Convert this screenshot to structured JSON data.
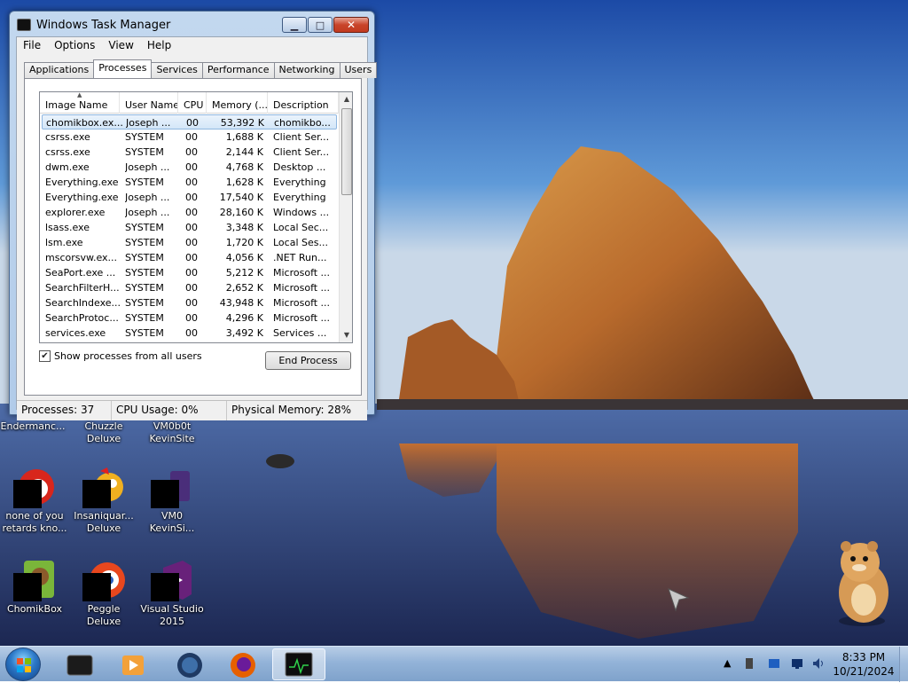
{
  "window": {
    "title": "Windows Task Manager",
    "minimize_glyph": "▁",
    "maximize_glyph": "□",
    "close_glyph": "✕"
  },
  "menu": [
    "File",
    "Options",
    "View",
    "Help"
  ],
  "tabs": [
    "Applications",
    "Processes",
    "Services",
    "Performance",
    "Networking",
    "Users"
  ],
  "active_tab": "Processes",
  "columns": [
    "Image Name",
    "User Name",
    "CPU",
    "Memory (...",
    "Description"
  ],
  "processes": [
    {
      "name": "chomikbox.ex...",
      "user": "Joseph ...",
      "cpu": "00",
      "mem": "53,392 K",
      "desc": "chomikbo..."
    },
    {
      "name": "csrss.exe",
      "user": "SYSTEM",
      "cpu": "00",
      "mem": "1,688 K",
      "desc": "Client Ser..."
    },
    {
      "name": "csrss.exe",
      "user": "SYSTEM",
      "cpu": "00",
      "mem": "2,144 K",
      "desc": "Client Ser..."
    },
    {
      "name": "dwm.exe",
      "user": "Joseph ...",
      "cpu": "00",
      "mem": "4,768 K",
      "desc": "Desktop ..."
    },
    {
      "name": "Everything.exe",
      "user": "SYSTEM",
      "cpu": "00",
      "mem": "1,628 K",
      "desc": "Everything"
    },
    {
      "name": "Everything.exe",
      "user": "Joseph ...",
      "cpu": "00",
      "mem": "17,540 K",
      "desc": "Everything"
    },
    {
      "name": "explorer.exe",
      "user": "Joseph ...",
      "cpu": "00",
      "mem": "28,160 K",
      "desc": "Windows ..."
    },
    {
      "name": "lsass.exe",
      "user": "SYSTEM",
      "cpu": "00",
      "mem": "3,348 K",
      "desc": "Local Sec..."
    },
    {
      "name": "lsm.exe",
      "user": "SYSTEM",
      "cpu": "00",
      "mem": "1,720 K",
      "desc": "Local Ses..."
    },
    {
      "name": "mscorsvw.ex...",
      "user": "SYSTEM",
      "cpu": "00",
      "mem": "4,056 K",
      "desc": ".NET Run..."
    },
    {
      "name": "SeaPort.exe ...",
      "user": "SYSTEM",
      "cpu": "00",
      "mem": "5,212 K",
      "desc": "Microsoft ..."
    },
    {
      "name": "SearchFilterH...",
      "user": "SYSTEM",
      "cpu": "00",
      "mem": "2,652 K",
      "desc": "Microsoft ..."
    },
    {
      "name": "SearchIndexe...",
      "user": "SYSTEM",
      "cpu": "00",
      "mem": "43,948 K",
      "desc": "Microsoft ..."
    },
    {
      "name": "SearchProtoc...",
      "user": "SYSTEM",
      "cpu": "00",
      "mem": "4,296 K",
      "desc": "Microsoft ..."
    },
    {
      "name": "services.exe",
      "user": "SYSTEM",
      "cpu": "00",
      "mem": "3,492 K",
      "desc": "Services ..."
    }
  ],
  "selected_row": 0,
  "show_all_label": "Show processes from all users",
  "show_all_checked": true,
  "end_process_label": "End Process",
  "status": {
    "processes": "Processes: 37",
    "cpu": "CPU Usage: 0%",
    "memory": "Physical Memory: 28%"
  },
  "desktop_icons": [
    {
      "label": "Endermanc...",
      "icon": "app-icon"
    },
    {
      "label": "Chuzzle Deluxe",
      "icon": "chuzzle-icon"
    },
    {
      "label": "VM0b0t KevinSite",
      "icon": "vm-icon"
    },
    {
      "label": "none of you retards kno...",
      "icon": "red-ball-icon"
    },
    {
      "label": "Insaniquar... Deluxe",
      "icon": "bird-icon"
    },
    {
      "label": "VM0 KevinSi...",
      "icon": "vm-icon"
    },
    {
      "label": "ChomikBox",
      "icon": "chomikbox-icon"
    },
    {
      "label": "Peggle Deluxe",
      "icon": "peggle-icon"
    },
    {
      "label": "Visual Studio 2015",
      "icon": "visual-studio-icon"
    }
  ],
  "clock": {
    "time": "8:33 PM",
    "date": "10/21/2024"
  },
  "tray_expand_glyph": "▲",
  "colors": {
    "accent": "#3a78c3",
    "close": "#c8442a",
    "selection": "#d3e6f8"
  }
}
